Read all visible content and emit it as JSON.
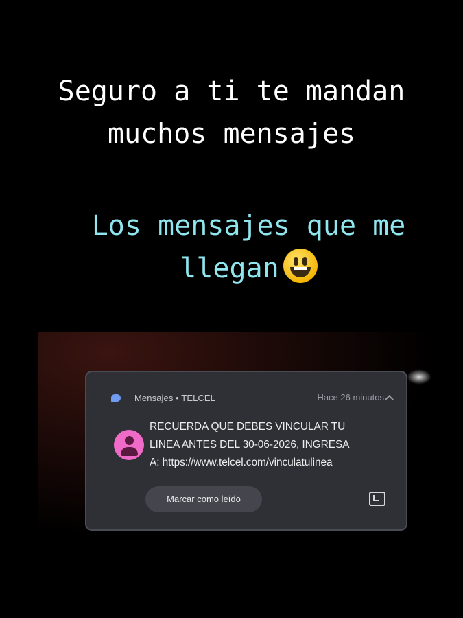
{
  "caption_top": {
    "line1": "Seguro a ti te mandan",
    "line2": "muchos mensajes"
  },
  "caption_bottom": {
    "line1": "Los mensajes que me",
    "line2": "llegan",
    "emoji": "grinning-face-icon"
  },
  "notification": {
    "app_name": "Mensajes • TELCEL",
    "time": "Hace 26 minutos",
    "message_lines": [
      "RECUERDA QUE DEBES VINCULAR TU",
      "LINEA ANTES DEL 30-06-2026, INGRESA",
      "A: https://www.telcel.com/vinculatulinea"
    ],
    "mark_read_label": "Marcar como leído",
    "icons": {
      "app": "message-bubble-icon",
      "expand": "chevron-up-icon",
      "avatar": "person-avatar-icon",
      "open": "open-in-app-icon"
    },
    "colors": {
      "card_bg": "#2f3035",
      "avatar_bg": "#f06bc8",
      "app_icon": "#6f9cf0"
    }
  },
  "colors": {
    "background": "#000000",
    "caption_top": "#ffffff",
    "caption_bottom": "#8fe6ee"
  }
}
